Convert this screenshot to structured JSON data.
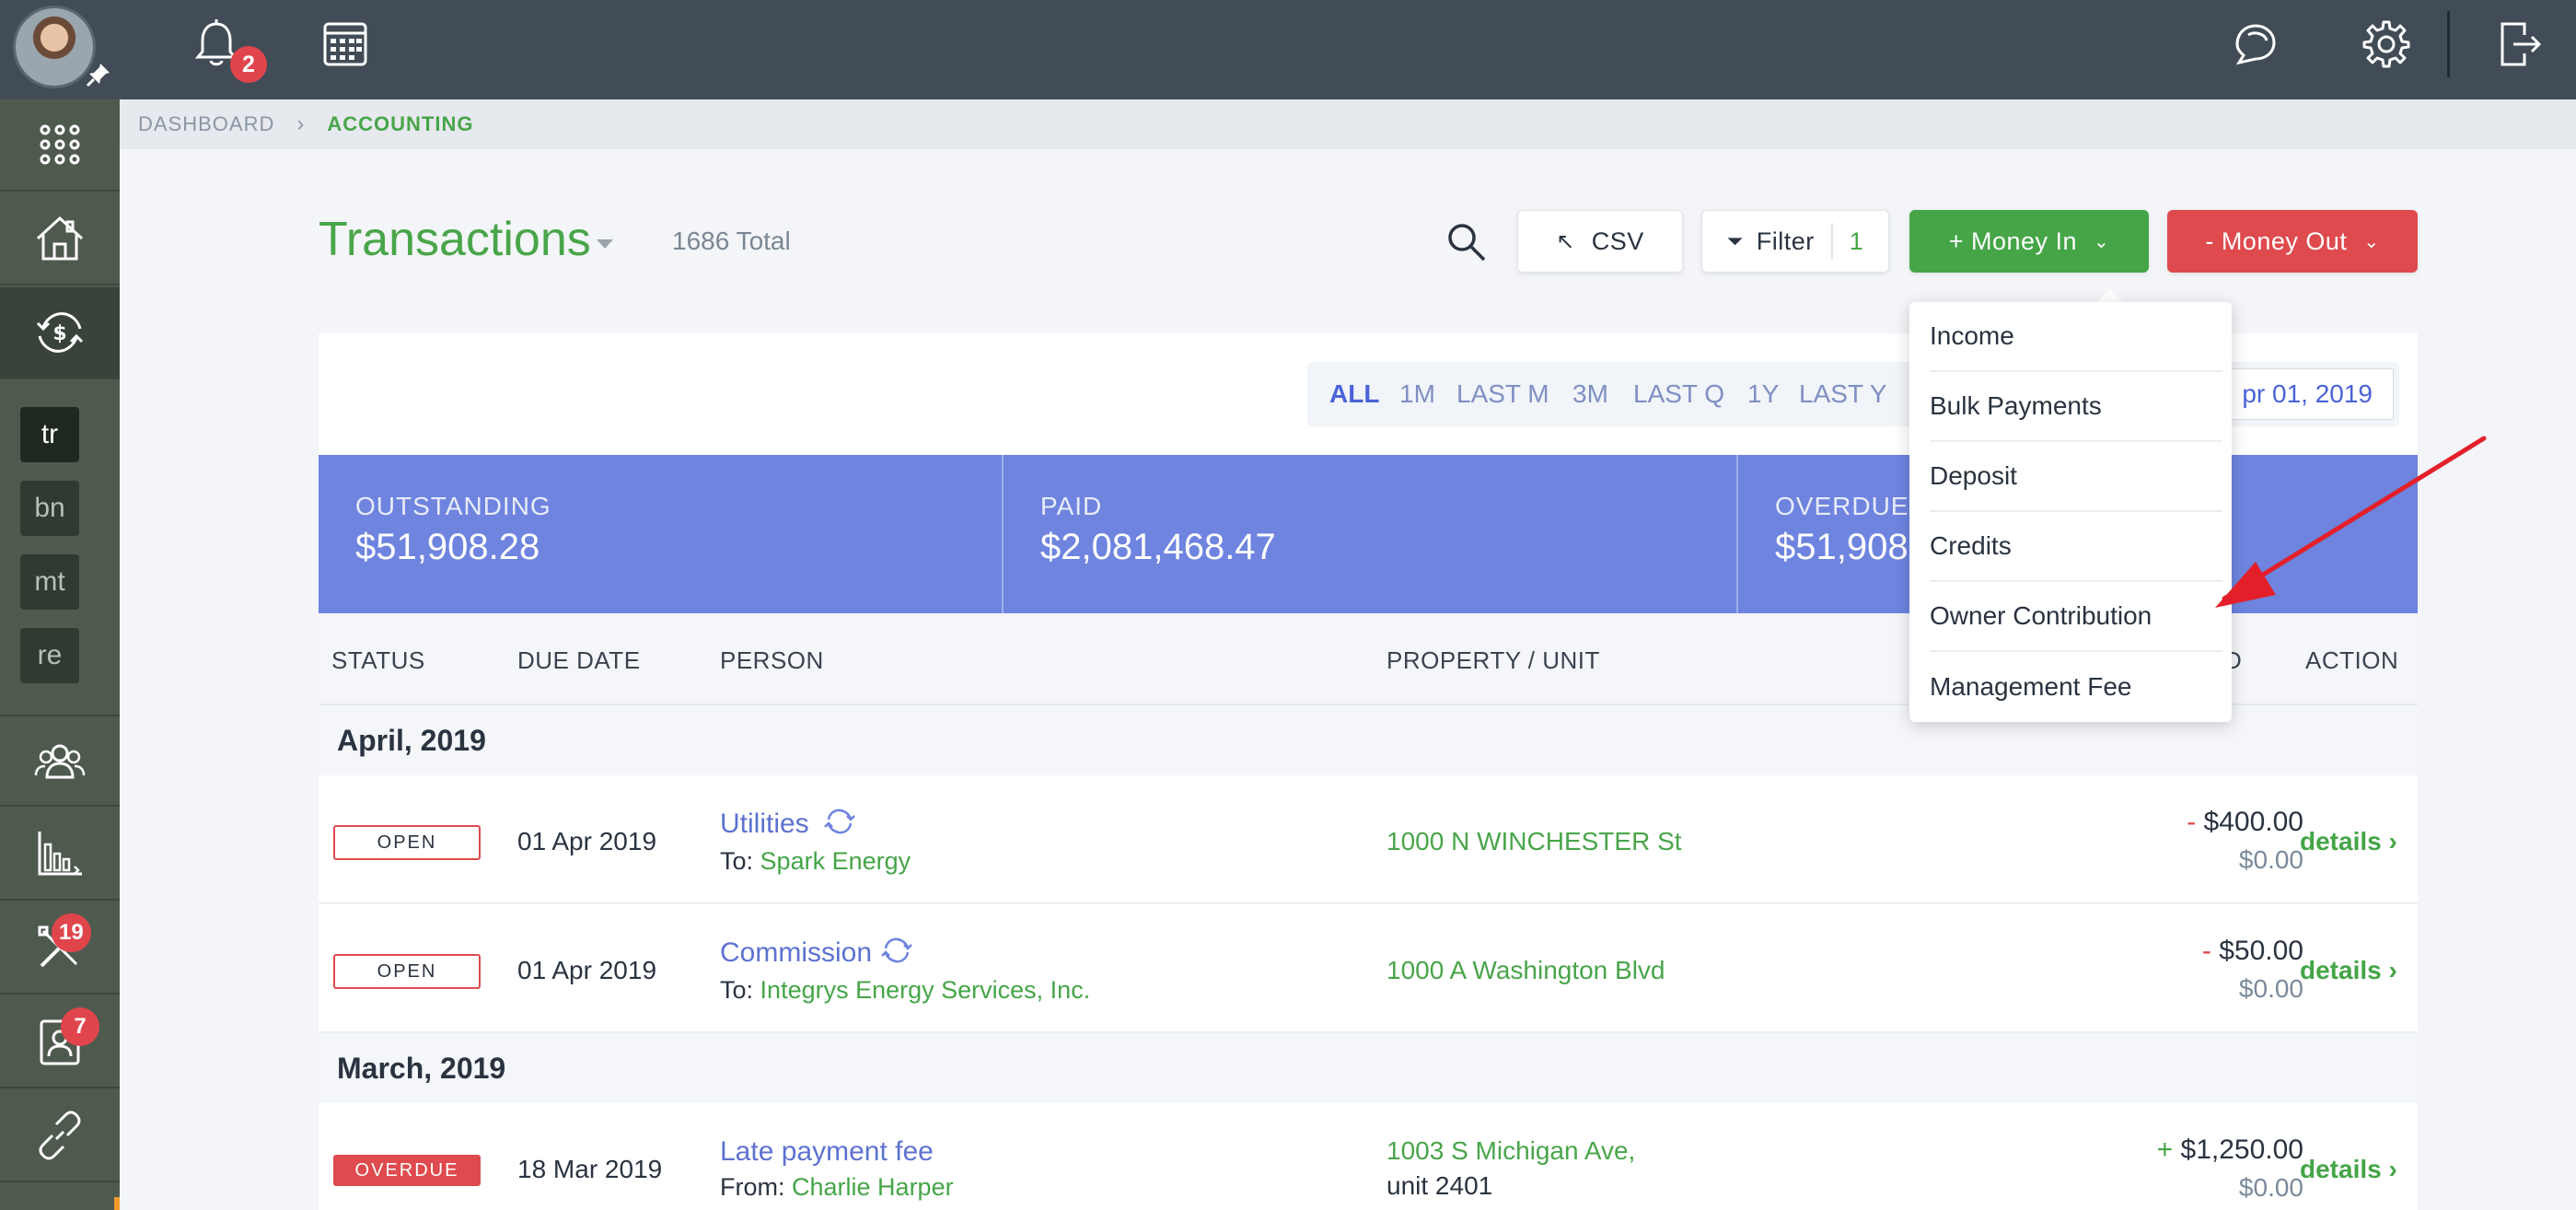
{
  "topbar": {
    "notifications_count": "2",
    "icons": [
      "bell-icon",
      "calendar-icon",
      "chat-icon",
      "gear-icon",
      "logout-icon"
    ]
  },
  "sidebar": {
    "tags": [
      "tr",
      "bn",
      "mt",
      "re"
    ],
    "badges": {
      "tools": "19",
      "tenant": "7"
    }
  },
  "breadcrumb": {
    "root": "DASHBOARD",
    "current": "ACCOUNTING"
  },
  "header": {
    "title": "Transactions",
    "total": "1686 Total",
    "csv_label": "CSV",
    "filter_label": "Filter",
    "filter_count": "1",
    "money_in_label": "+  Money In",
    "money_out_label": "-  Money Out"
  },
  "periods": {
    "options": [
      "ALL",
      "1M",
      "LAST M",
      "3M",
      "LAST Q",
      "1Y",
      "LAST Y"
    ],
    "active": "ALL",
    "date_value": "pr 01, 2019"
  },
  "stats": [
    {
      "label": "OUTSTANDING",
      "value": "$51,908.28"
    },
    {
      "label": "PAID",
      "value": "$2,081,468.47"
    },
    {
      "label": "OVERDUE",
      "value": "$51,908"
    }
  ],
  "table": {
    "headers": {
      "status": "STATUS",
      "due_date": "DUE DATE",
      "person": "PERSON",
      "property": "PROPERTY / UNIT",
      "amount_fragment": "D",
      "action": "ACTION"
    },
    "groups": [
      {
        "label": "April, 2019",
        "rows": [
          {
            "status": "OPEN",
            "date": "01 Apr 2019",
            "title": "Utilities",
            "direction": "To:",
            "name": "Spark Energy",
            "property": "1000 N WINCHESTER St",
            "property_sub": "",
            "sign": "-",
            "amount": "$400.00",
            "paid": "$0.00",
            "action": "details"
          },
          {
            "status": "OPEN",
            "date": "01 Apr 2019",
            "title": "Commission",
            "direction": "To:",
            "name": "Integrys Energy Services, Inc.",
            "property": "1000 A Washington Blvd",
            "property_sub": "",
            "sign": "-",
            "amount": "$50.00",
            "paid": "$0.00",
            "action": "details"
          }
        ]
      },
      {
        "label": "March, 2019",
        "rows": [
          {
            "status": "OVERDUE",
            "date": "18 Mar 2019",
            "title": "Late payment fee",
            "direction": "From:",
            "name": "Charlie Harper",
            "property": "1003 S Michigan Ave,",
            "property_sub": "unit 2401",
            "sign": "+",
            "amount": "$1,250.00",
            "paid": "$0.00",
            "action": "details"
          }
        ]
      }
    ]
  },
  "money_in_menu": {
    "items": [
      "Income",
      "Bulk Payments",
      "Deposit",
      "Credits",
      "Owner Contribution",
      "Management Fee"
    ]
  },
  "colors": {
    "accent_green": "#45a547",
    "accent_red": "#de4a4d",
    "stats_blue": "#6e84df",
    "annotation_arrow": "#e3202a"
  }
}
